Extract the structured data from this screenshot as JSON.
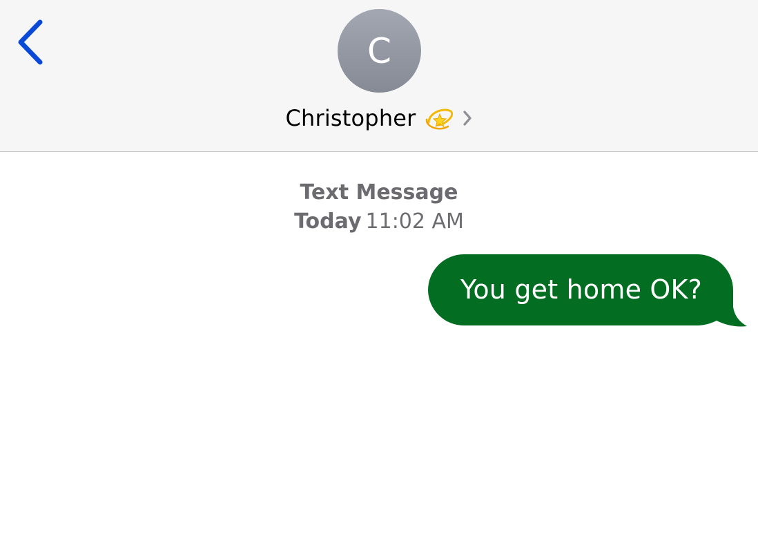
{
  "header": {
    "back_icon": "chevron-left-icon",
    "avatar_initial": "C",
    "contact_name": "Christopher",
    "name_emoji": "dizzy-star-emoji",
    "disclosure_icon": "chevron-right-icon"
  },
  "conversation": {
    "service_label": "Text Message",
    "day_label": "Today",
    "time_label": "11:02 AM",
    "messages": [
      {
        "direction": "outgoing",
        "text": "You get home OK?"
      }
    ]
  },
  "colors": {
    "accent": "#0a49d8",
    "header_bg": "#f6f6f6",
    "avatar_top": "#a3a7b1",
    "avatar_bottom": "#868a95",
    "outgoing_bubble": "#036d22",
    "meta_text": "#6b6b70"
  }
}
